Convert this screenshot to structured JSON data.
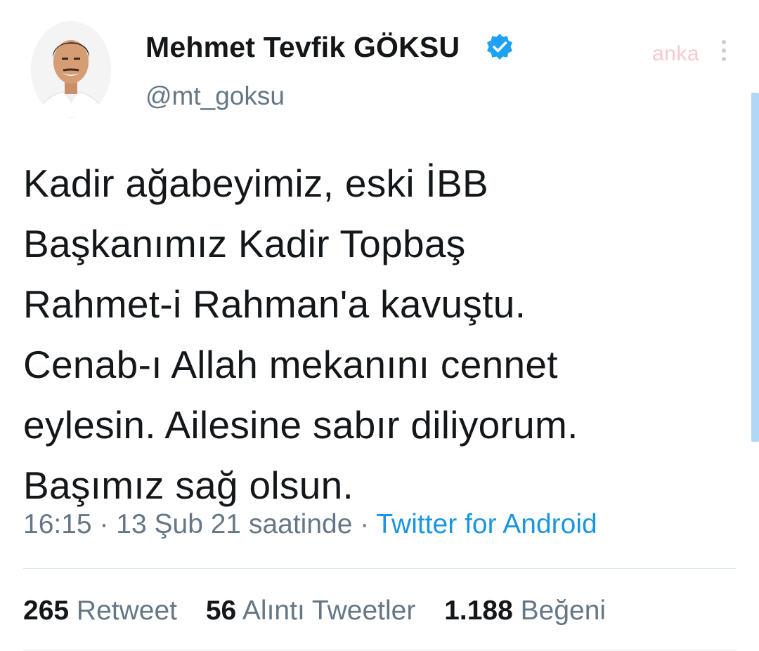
{
  "author": {
    "name": "Mehmet Tevfik GÖKSU",
    "handle": "@mt_goksu",
    "verified_icon": "verified-badge-icon",
    "verified_color": "#1da1f2"
  },
  "watermark": "anka",
  "tweet": {
    "lines": [
      "Kadir ağabeyimiz, eski İBB",
      "Başkanımız Kadir Topbaş",
      "Rahmet-i Rahman'a kavuştu.",
      "Cenab-ı Allah mekanını cennet",
      "eylesin. Ailesine sabır diliyorum.",
      "Başımız sağ olsun."
    ],
    "time": "16:15",
    "date_text": "13 Şub 21 saatinde",
    "separator": "·",
    "source": "Twitter for Android"
  },
  "stats": {
    "retweets": {
      "count": "265",
      "label": "Retweet"
    },
    "quotes": {
      "count": "56",
      "label": "Alıntı Tweetler"
    },
    "likes": {
      "count": "1.188",
      "label": "Beğeni"
    }
  },
  "colors": {
    "text": "#14171a",
    "muted": "#657786",
    "link": "#1b95e0",
    "divider": "#e1e8ed"
  }
}
